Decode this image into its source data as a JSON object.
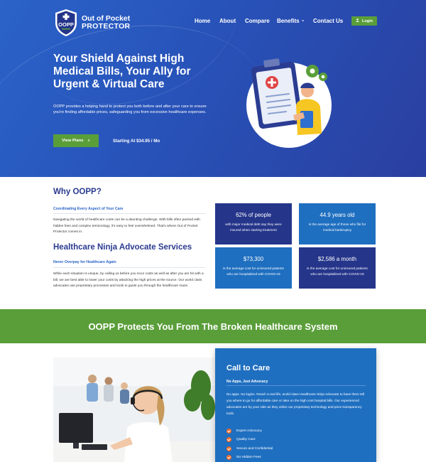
{
  "header": {
    "logo": {
      "badge_text": "OOPP",
      "line1": "Out of Pocket",
      "line2": "PROTECTOR"
    },
    "nav": [
      "Home",
      "About",
      "Compare",
      "Benefits",
      "Contact Us"
    ],
    "benefits_chevron": "⌄",
    "login_label": "Login",
    "icons": {
      "login": "user-icon"
    }
  },
  "hero": {
    "title": "Your Shield Against High Medical Bills, Your Ally for Urgent & Virtual Care",
    "description": "OOPP provides a helping hand to protect you both before and after your care to ensure you're finding affordable prices, safeguarding you from excessive healthcare expenses.",
    "cta_label": "View Plans",
    "cta_arrow": "»",
    "price_text": "Starting At $34.95 / Mo"
  },
  "why": {
    "title": "Why OOPP?",
    "subtitle": "Coordinating Every Aspect of Your Care",
    "text": "Navigating the world of healthcare costs can be a daunting challenge. With bills often packed with hidden fees and complex terminology, it's easy to feel overwhelmed. That's where Out of Pocket Protector comes in.",
    "ninja_title": "Healthcare Ninja Advocate Services",
    "ninja_subtitle": "Never Overpay for Healthcare Again",
    "ninja_text": "While each situation is unique, by calling us before you incur costs as well as after you are hit with a bill, we are best able to lower your costs by attacking the high prices at the source. Our world class advocates use proprietary processes and tools to guide you through the healthcare maze."
  },
  "stats": [
    {
      "value": "62% of people",
      "label": "with major medical debt say they were insured when starting treatment"
    },
    {
      "value": "44.9 years old",
      "label": "is the average age of those who file for medical bankruptcy"
    },
    {
      "value": "$73,300",
      "label": "is the average cost for uninsured patients who are hospitalized with COVID-19"
    },
    {
      "value": "$2,586 a month",
      "label": "is the average cost for uninsured patients who are hospitalized with COVID-19"
    }
  ],
  "banner": {
    "text": "OOPP Protects You From The Broken Healthcare System"
  },
  "care": {
    "title": "Call to Care",
    "subtitle": "No Apps, Just Advocacy",
    "text": "No apps. No logins. Reach a real life, world class Healthcare Ninja Advocate to have them tell you where to go for affordable care or take on the high cost hospital bills. Our experienced advocates are by your side as they utilize our proprietary technology and price transparency tools.",
    "items": [
      "Expert Advocacy",
      "Quality Care",
      "Secure and Confidential",
      "No Hidden Fees"
    ]
  },
  "colors": {
    "hero_blue": "#2852b8",
    "navy": "#25358a",
    "blue": "#1f6fc0",
    "green": "#5a9e3a",
    "check_orange": "#e86a2a"
  }
}
